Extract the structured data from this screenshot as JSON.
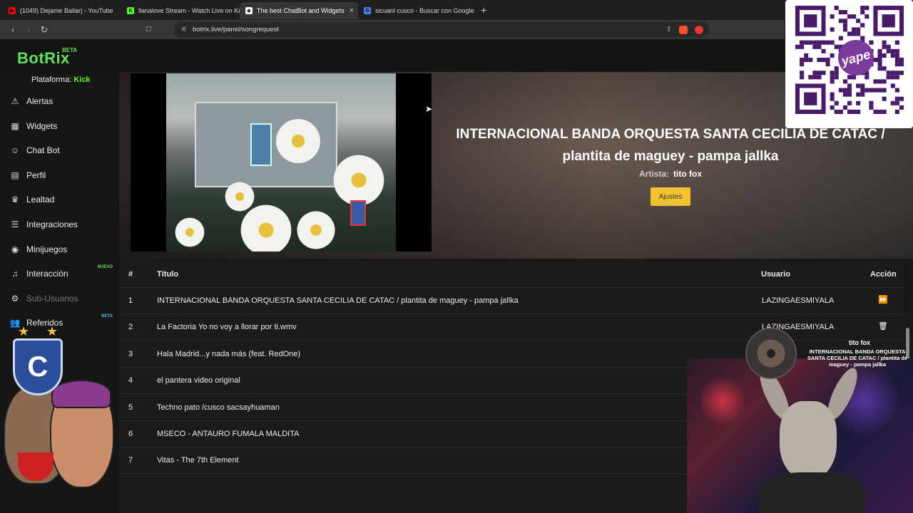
{
  "browser": {
    "tabs": [
      {
        "label": "(1049) Dejame Bailar| - YouTube",
        "color": "#ff0000",
        "glyph": "▶"
      },
      {
        "label": "llanalove Stream - Watch Live on Kick",
        "color": "#53fc18",
        "glyph": "K"
      },
      {
        "label": "The best ChatBot and Widgets",
        "color": "#ffffff",
        "glyph": "◆",
        "active": true
      },
      {
        "label": "sicuani cusco - Buscar con Google",
        "color": "#4285f4",
        "glyph": "G"
      }
    ],
    "url": "botrix.live/panel/songrequest"
  },
  "app": {
    "logo": "BotRix",
    "logo_badge": "BETA",
    "platform_label": "Plataforma:",
    "platform_value": "Kick"
  },
  "sidebar": {
    "items": [
      {
        "label": "Alertas",
        "icon": "warning-icon",
        "glyph": "⚠"
      },
      {
        "label": "Widgets",
        "icon": "grid-icon",
        "glyph": "▦"
      },
      {
        "label": "Chat Bot",
        "icon": "robot-icon",
        "glyph": "☺"
      },
      {
        "label": "Perfil",
        "icon": "id-card-icon",
        "glyph": "▤"
      },
      {
        "label": "Lealtad",
        "icon": "trophy-icon",
        "glyph": "♛"
      },
      {
        "label": "Integraciones",
        "icon": "list-icon",
        "glyph": "☰"
      },
      {
        "label": "Minijuegos",
        "icon": "gamepad-icon",
        "glyph": "◉"
      },
      {
        "label": "Interacción",
        "icon": "music-icon",
        "glyph": "♫",
        "tag": "NUEVO",
        "tag_color": "#5ee35a"
      },
      {
        "label": "Sub-Usuarios",
        "icon": "user-cog-icon",
        "glyph": "⚙",
        "muted": true
      },
      {
        "label": "Referidos",
        "icon": "users-icon",
        "glyph": "👥",
        "tag": "BETA",
        "tag_color": "#4ab3e8"
      }
    ]
  },
  "now": {
    "title": "INTERNACIONAL BANDA ORQUESTA SANTA CECILIA DE CATAC / plantita de maguey - pampa jallka",
    "artist_label": "Artista:",
    "artist": "tito fox",
    "settings_button": "Ajustes"
  },
  "table": {
    "headers": {
      "num": "#",
      "title": "Título",
      "user": "Usuario",
      "action": "Acción"
    },
    "rows": [
      {
        "n": "1",
        "title": "INTERNACIONAL BANDA ORQUESTA SANTA CECILIA DE CATAC / plantita de maguey - pampa jallka",
        "user": "LAZINGAESMIYALA",
        "action": "⏩",
        "action_icon": "skip-forward-icon"
      },
      {
        "n": "2",
        "title": "La Factoria Yo no voy a llorar por ti.wmv",
        "user": "LAZINGAESMIYALA",
        "action": "🗑",
        "action_icon": "trash-icon"
      },
      {
        "n": "3",
        "title": "Hala Madrid...y nada más (feat. RedOne)",
        "user": "",
        "action": ""
      },
      {
        "n": "4",
        "title": "el pantera video original",
        "user": "",
        "action": ""
      },
      {
        "n": "5",
        "title": "Techno pato /cusco sacsayhuaman",
        "user": "",
        "action": ""
      },
      {
        "n": "6",
        "title": "MSECO - ANTAURO FUMALA MALDITA",
        "user": "",
        "action": ""
      },
      {
        "n": "7",
        "title": "Vitas - The 7th Element",
        "user": "",
        "action": ""
      }
    ]
  },
  "overlay": {
    "qr_brand": "yape",
    "now_playing_user": "tito fox",
    "now_playing_title": "INTERNACIONAL BANDA ORQUESTA SANTA CECILIA DE CATAC / plantita de maguey - pampa jallka"
  }
}
